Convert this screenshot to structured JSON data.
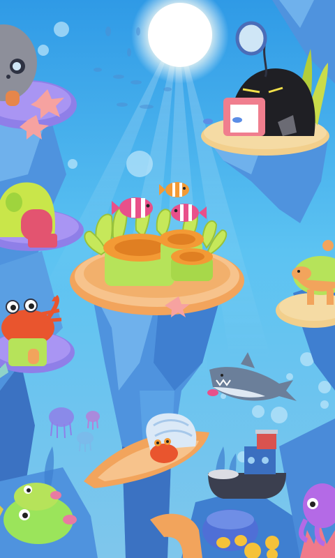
{
  "scene": {
    "name": "underwater-home-map",
    "palette": {
      "sky_top": "#2f9ae6",
      "sky_mid": "#5cc3f2",
      "sky_bottom": "#7fc6ec",
      "sun": "#ffffff",
      "rock_light": "#6fb1ec",
      "rock_mid": "#4f93de",
      "rock_dark": "#3b72c2",
      "platform_purple": "#8f7fe8",
      "platform_orange": "#f2a45c",
      "platform_sand": "#f2cf8c",
      "anemone_green": "#b6e35a",
      "anemone_orange": "#f39a35",
      "starfish": "#f6a2a0",
      "crab": "#e9552e",
      "shark": "#6b7f9a",
      "octopus": "#b46ae6",
      "fish_green": "#9be45b"
    },
    "buildings": [
      {
        "id": "skull-house",
        "icon": "skull-house-icon"
      },
      {
        "id": "lantern-fish-house",
        "icon": "lantern-fish-house-icon"
      },
      {
        "id": "shell-house",
        "icon": "shell-house-icon"
      },
      {
        "id": "anemone-center",
        "icon": "anemone-icon"
      },
      {
        "id": "crab-house",
        "icon": "crab-house-icon"
      },
      {
        "id": "turtle-house",
        "icon": "turtle-icon"
      },
      {
        "id": "hermit-crab-boat",
        "icon": "hermit-crab-icon"
      },
      {
        "id": "shipwreck",
        "icon": "boat-icon"
      },
      {
        "id": "clam-shop",
        "icon": "clam-icon"
      },
      {
        "id": "octopus-house",
        "icon": "octopus-icon"
      }
    ]
  }
}
